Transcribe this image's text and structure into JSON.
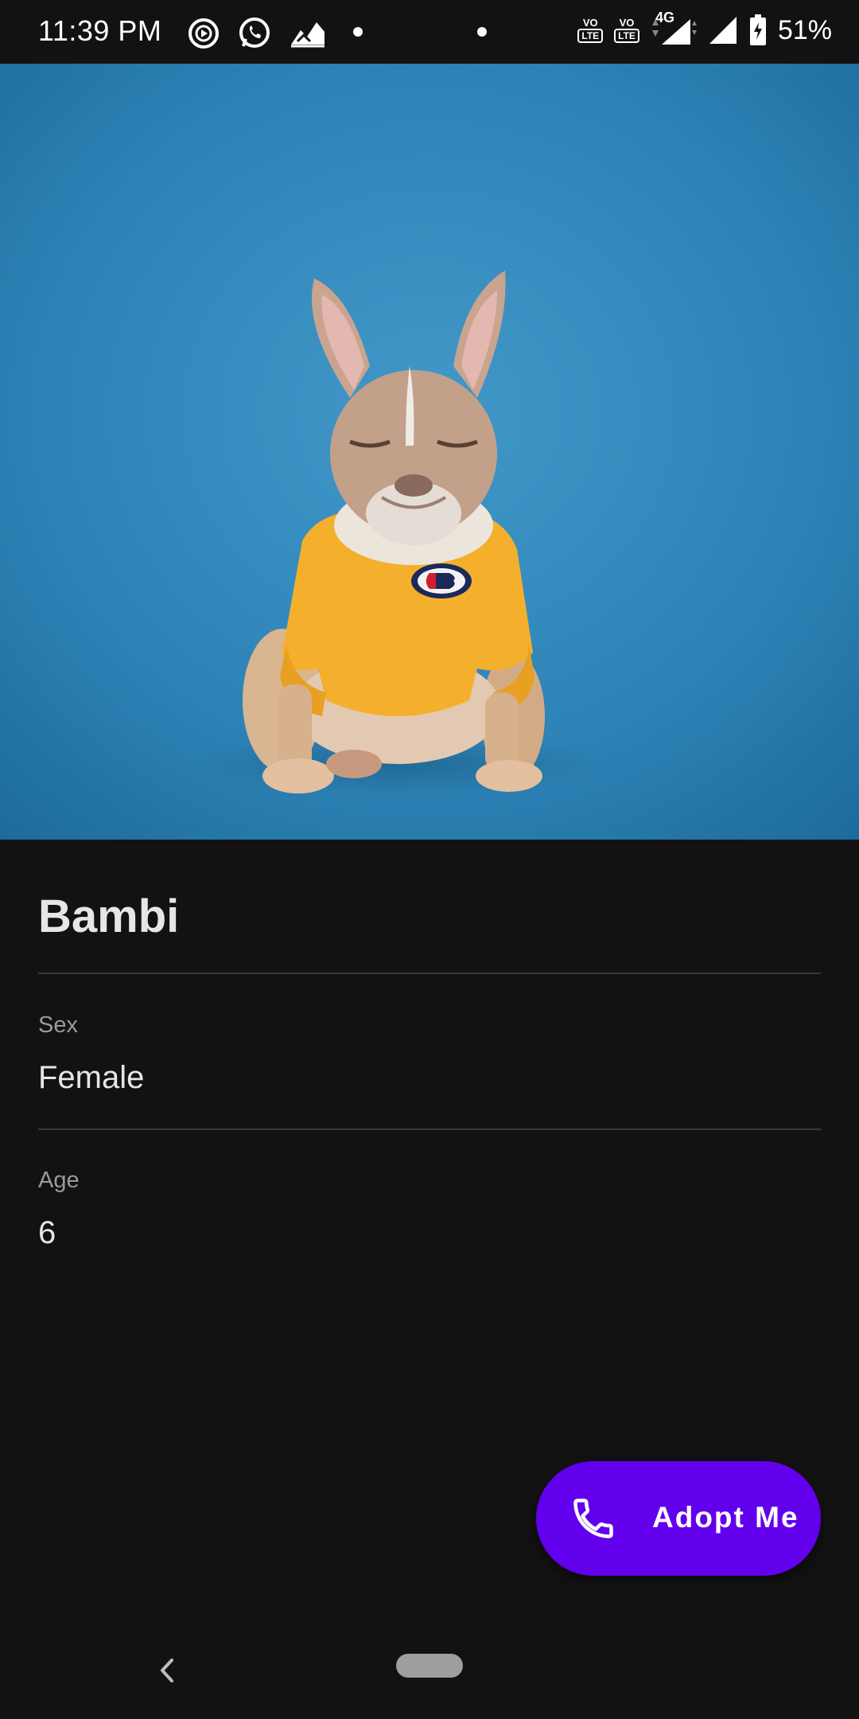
{
  "status_bar": {
    "time": "11:39 PM",
    "battery": "51%",
    "network": "4G",
    "left_icons": [
      "play-circle-icon",
      "whatsapp-icon",
      "stocks-icon",
      "dot-icon"
    ],
    "right_icons": [
      "dot-icon",
      "volte-1-icon",
      "volte-wifi-icon",
      "4g-signal-icon",
      "signal-icon",
      "battery-icon"
    ],
    "volte1": "VO",
    "lte": "LTE"
  },
  "hero": {
    "subject": "french-bulldog-photo",
    "background_color": "#2f86b9"
  },
  "pet": {
    "name": "Bambi",
    "fields": [
      {
        "label": "Sex",
        "value": "Female"
      },
      {
        "label": "Age",
        "value": "6"
      }
    ]
  },
  "fab": {
    "label": "Adopt Me",
    "icon": "phone-icon",
    "color": "#6200ee"
  },
  "nav": {
    "back_icon": "back-chevron-icon",
    "home_icon": "home-pill-icon"
  }
}
